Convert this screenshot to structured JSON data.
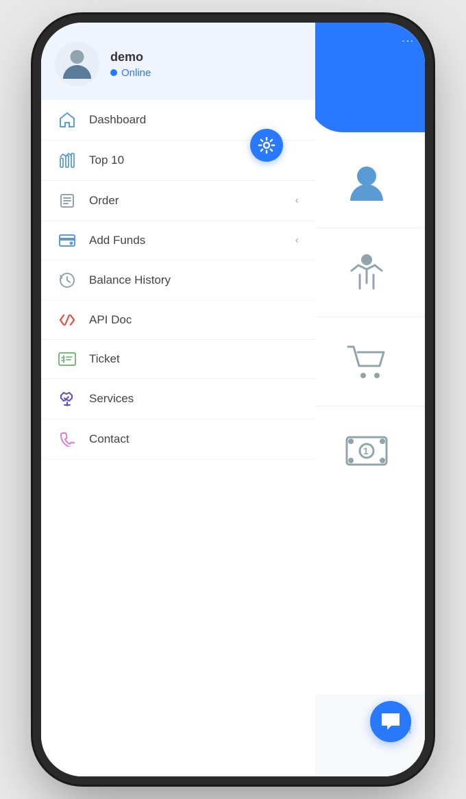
{
  "phone": {
    "screen": {
      "right_panel": {
        "dots_icon": "⋮",
        "icons": [
          {
            "name": "user",
            "label": "user-icon"
          },
          {
            "name": "person-arms",
            "label": "person-arms-icon"
          },
          {
            "name": "cart",
            "label": "cart-icon"
          },
          {
            "name": "money",
            "label": "money-icon"
          }
        ]
      },
      "sidebar": {
        "settings_label": "settings",
        "user": {
          "name": "demo",
          "status": "Online"
        },
        "nav_items": [
          {
            "id": "dashboard",
            "label": "Dashboard",
            "icon": "home",
            "chevron": false
          },
          {
            "id": "top10",
            "label": "Top 10",
            "icon": "top10",
            "chevron": false
          },
          {
            "id": "order",
            "label": "Order",
            "icon": "order",
            "chevron": true
          },
          {
            "id": "addfunds",
            "label": "Add Funds",
            "icon": "addfunds",
            "chevron": true
          },
          {
            "id": "balancehistory",
            "label": "Balance History",
            "icon": "history",
            "chevron": false
          },
          {
            "id": "apidoc",
            "label": "API Doc",
            "icon": "api",
            "chevron": false
          },
          {
            "id": "ticket",
            "label": "Ticket",
            "icon": "ticket",
            "chevron": false
          },
          {
            "id": "services",
            "label": "Services",
            "icon": "services",
            "chevron": false
          },
          {
            "id": "contact",
            "label": "Contact",
            "icon": "contact",
            "chevron": false
          }
        ]
      },
      "chat_button": {
        "label": "chat"
      },
      "bottom": {
        "text": "t"
      }
    }
  }
}
